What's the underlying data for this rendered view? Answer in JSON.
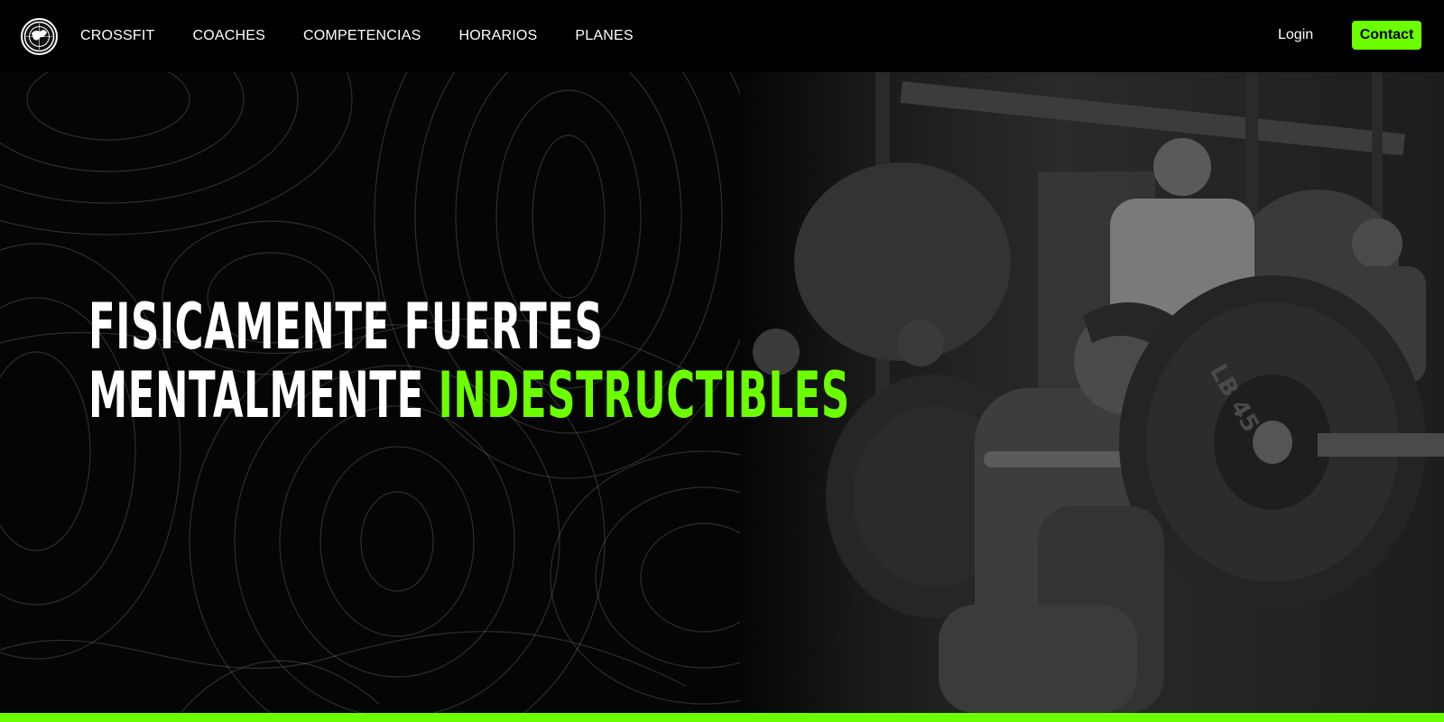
{
  "nav": {
    "links": [
      "CROSSFIT",
      "COACHES",
      "COMPETENCIAS",
      "HORARIOS",
      "PLANES"
    ],
    "login": "Login",
    "contact": "Contact"
  },
  "hero": {
    "line1": "FISICAMENTE FUERTES",
    "line2_prefix": "MENTALMENTE",
    "line2_accent": "INDESTRUCTIBLES",
    "plate_text": "LB 45"
  },
  "colors": {
    "accent": "#6cff00",
    "background": "#000000",
    "text": "#ffffff"
  }
}
